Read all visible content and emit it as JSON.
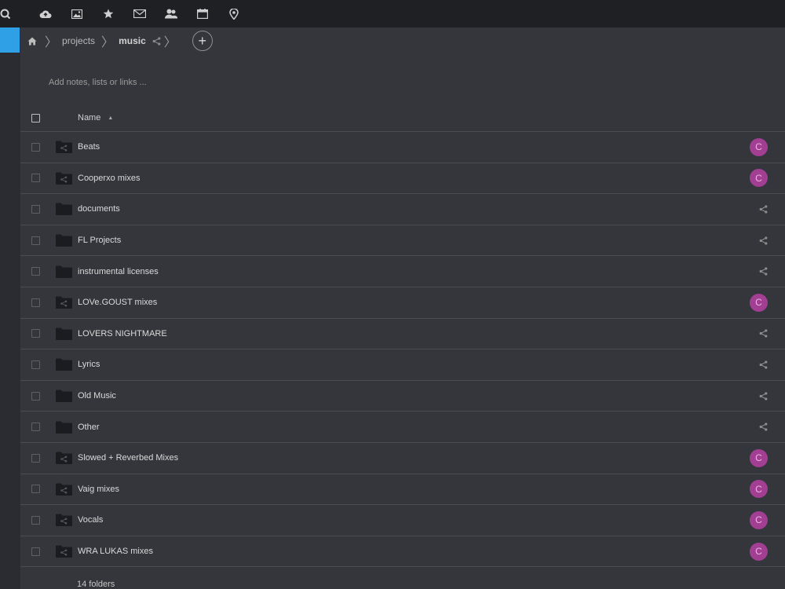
{
  "topbar": {
    "apps": [
      {
        "name": "search-icon"
      },
      {
        "name": "cloud-icon"
      },
      {
        "name": "photos-icon"
      },
      {
        "name": "star-icon"
      },
      {
        "name": "mail-icon"
      },
      {
        "name": "contacts-icon"
      },
      {
        "name": "calendar-icon"
      },
      {
        "name": "maps-icon"
      }
    ]
  },
  "breadcrumb": {
    "home_icon": "home-icon",
    "items": [
      "projects",
      "music"
    ],
    "share_icon": "share-icon",
    "add_label": "+"
  },
  "notes": {
    "placeholder": "Add notes, lists or links ..."
  },
  "table": {
    "name_header": "Name",
    "sort_indicator": "▲",
    "rows": [
      {
        "name": "Beats",
        "shared": true,
        "owner_initial": "C"
      },
      {
        "name": "Cooperxo mixes",
        "shared": true,
        "owner_initial": "C"
      },
      {
        "name": "documents",
        "shared": false
      },
      {
        "name": "FL Projects",
        "shared": false
      },
      {
        "name": "instrumental licenses",
        "shared": false
      },
      {
        "name": "LOVe.GOUST mixes",
        "shared": true,
        "owner_initial": "C"
      },
      {
        "name": "LOVERS NIGHTMARE",
        "shared": false
      },
      {
        "name": "Lyrics",
        "shared": false
      },
      {
        "name": "Old Music",
        "shared": false
      },
      {
        "name": "Other",
        "shared": false
      },
      {
        "name": "Slowed + Reverbed Mixes",
        "shared": true,
        "owner_initial": "C"
      },
      {
        "name": "Vaig mixes",
        "shared": true,
        "owner_initial": "C"
      },
      {
        "name": "Vocals",
        "shared": true,
        "owner_initial": "C"
      },
      {
        "name": "WRA LUKAS mixes",
        "shared": true,
        "owner_initial": "C"
      }
    ],
    "summary": "14 folders"
  },
  "colors": {
    "accent": "#2f9fe6",
    "avatar": "#a23f93"
  }
}
